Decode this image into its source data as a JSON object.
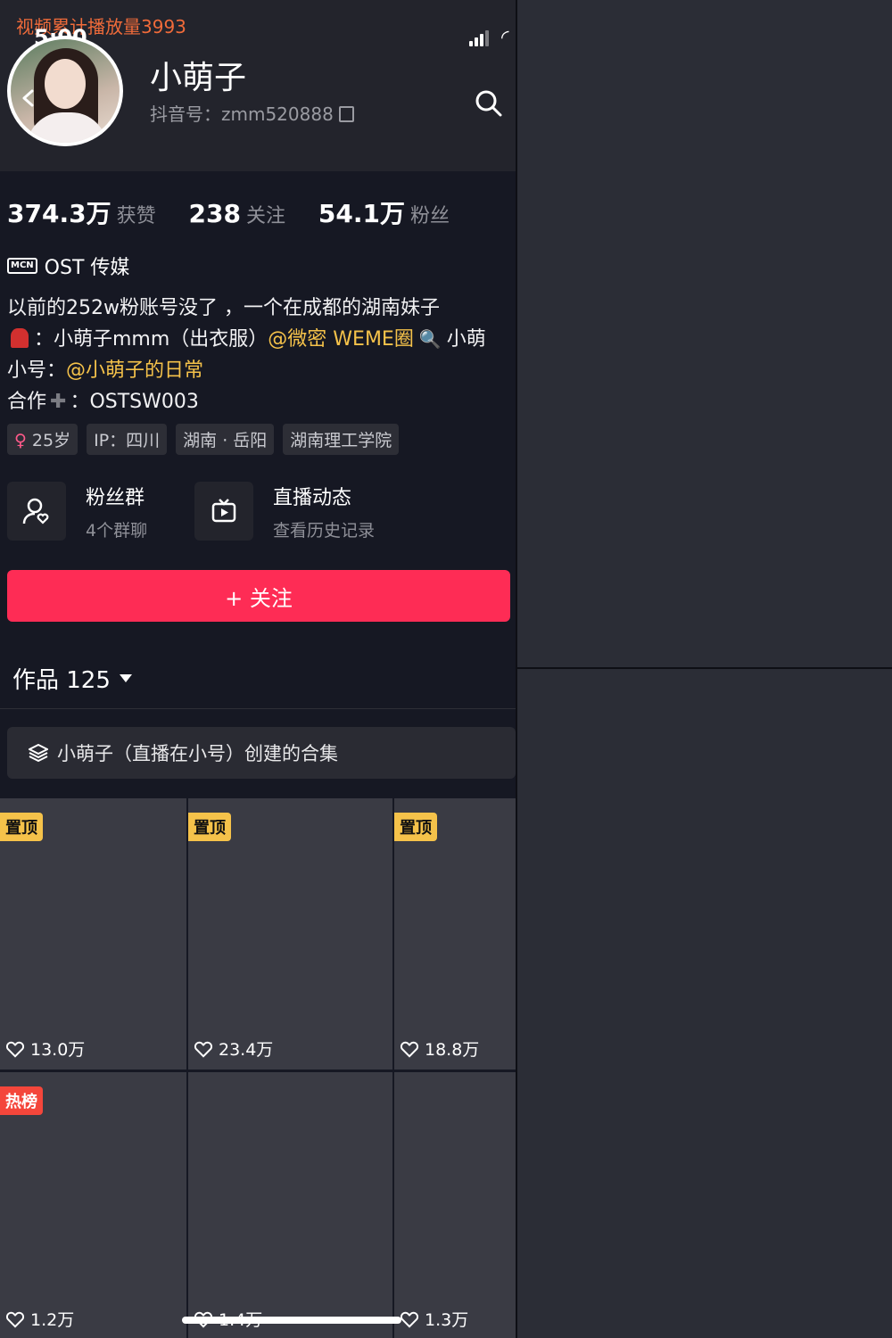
{
  "watermark": "视频累计播放量3993",
  "status": {
    "time": "5:00"
  },
  "profile": {
    "name": "小萌子",
    "account": "抖音号：zmm520888"
  },
  "stats": [
    {
      "value": "374.3万",
      "label": "获赞"
    },
    {
      "value": "238",
      "label": "关注"
    },
    {
      "value": "54.1万",
      "label": "粉丝"
    }
  ],
  "mcn": {
    "badge": "MCN",
    "name": "OST 传媒"
  },
  "bio": {
    "line1": "以前的252w粉账号没了 ，一个在成都的湖南妹子",
    "line2_a": "：小萌子mmm（出衣服）",
    "line2_mention": "@微密 WEME圈",
    "line2_b": "小萌",
    "line3_label": "小号：",
    "line3_mention": "@小萌子的日常",
    "line4_a": "合作",
    "line4_b": "：OSTSW003"
  },
  "tags": [
    "25岁",
    "IP：四川",
    "湖南 · 岳阳",
    "湖南理工学院"
  ],
  "features": [
    {
      "title": "粉丝群",
      "sub": "4个群聊",
      "icon": "fan-group-icon"
    },
    {
      "title": "直播动态",
      "sub": "查看历史记录",
      "icon": "live-tv-icon"
    }
  ],
  "follow_button": "+ 关注",
  "works_tab": "作品 125",
  "collection": "小萌子（直播在小号）创建的合集",
  "videos": [
    {
      "likes": "13.0万",
      "badge": "置顶"
    },
    {
      "likes": "23.4万",
      "badge": "置顶"
    },
    {
      "likes": "18.8万",
      "badge": "置顶"
    },
    {
      "likes": "1.2万",
      "badge": "热榜"
    },
    {
      "likes": "1.4万",
      "badge": ""
    },
    {
      "likes": "1.3万",
      "badge": ""
    }
  ]
}
